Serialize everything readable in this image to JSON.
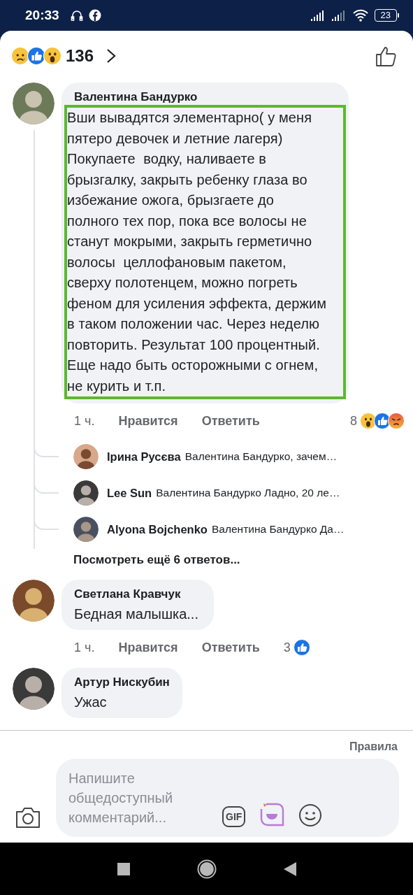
{
  "status_bar": {
    "time": "20:33",
    "battery": "23"
  },
  "reactions_header": {
    "count": "136"
  },
  "comments": [
    {
      "author": "Валентина Бандурко",
      "text": "Вши вывадятся элементарно( у меня\nпятеро девочек и летние лагеря)\nПокупаете  водку, наливаете в\nбрызгалку, закрыть ребенку глаза во\nизбежание ожога, брызгаете до\nполного тех пор, пока все волосы не\nстанут мокрыми, закрыть герметично\nволосы  целлофановым пакетом,\nсверху полотенцем, можно погреть\nфеном для усиления эффекта, держим\nв таком положении час. Через неделю\nповторить. Результат 100 процентный.\nЕще надо быть осторожными с огнем,\nне курить и т.п.",
      "highlighted": true,
      "time": "1 ч.",
      "like": "Нравится",
      "reply": "Ответить",
      "reaction_count": "8",
      "replies": [
        {
          "author": "Ірина Русєва",
          "text": "Валентина Бандурко, зачем…"
        },
        {
          "author": "Lee Sun",
          "text": "Валентина Бандурко Ладно, 20 ле…"
        },
        {
          "author": "Alyona Bojchenko",
          "text": "Валентина Бандурко Да…"
        }
      ],
      "more_replies": "Посмотреть ещё 6 ответов..."
    },
    {
      "author": "Светлана Кравчук",
      "text": "Бедная малышка...",
      "highlighted": false,
      "time": "1 ч.",
      "like": "Нравится",
      "reply": "Ответить",
      "reaction_count": "3"
    },
    {
      "author": "Артур Нискубин",
      "text": "Ужас",
      "highlighted": false
    }
  ],
  "rules_link": "Правила",
  "composer": {
    "placeholder": "Напишите общедоступный комментарий...",
    "gif_label": "GIF"
  }
}
